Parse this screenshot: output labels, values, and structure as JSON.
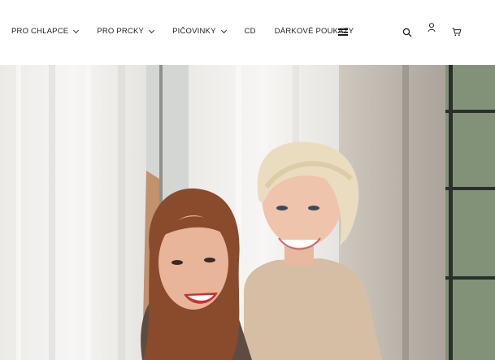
{
  "nav": {
    "items": [
      {
        "label": "PRO CHLAPCE",
        "dropdown": true
      },
      {
        "label": "PRO PRCKY",
        "dropdown": true
      },
      {
        "label": "PIČOVINKY",
        "dropdown": true
      },
      {
        "label": "CD",
        "dropdown": false
      },
      {
        "label": "DÁRKOVÉ POUKAZY",
        "dropdown": false
      }
    ]
  },
  "icons": {
    "menu": "hamburger-menu-icon",
    "search": "search-icon",
    "account": "user-icon",
    "cart": "cart-icon"
  },
  "hero": {
    "image": "hero-photo",
    "subject": "two smiling women by a window with white curtains"
  },
  "colors": {
    "header_bg": "#ffffff",
    "text": "#1d1d1d"
  }
}
